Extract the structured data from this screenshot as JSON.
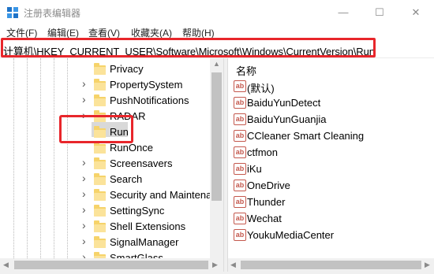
{
  "window": {
    "title": "注册表编辑器",
    "minimize_glyph": "—",
    "maximize_glyph": "☐",
    "close_glyph": "✕"
  },
  "menu": [
    "文件(F)",
    "编辑(E)",
    "查看(V)",
    "收藏夹(A)",
    "帮助(H)"
  ],
  "address": "计算机\\HKEY_CURRENT_USER\\Software\\Microsoft\\Windows\\CurrentVersion\\Run",
  "tree": {
    "items": [
      {
        "label": "Privacy",
        "has_children": false,
        "selected": false
      },
      {
        "label": "PropertySystem",
        "has_children": true,
        "selected": false
      },
      {
        "label": "PushNotifications",
        "has_children": true,
        "selected": false
      },
      {
        "label": "RADAR",
        "has_children": true,
        "selected": false
      },
      {
        "label": "Run",
        "has_children": false,
        "selected": true
      },
      {
        "label": "RunOnce",
        "has_children": false,
        "selected": false
      },
      {
        "label": "Screensavers",
        "has_children": true,
        "selected": false
      },
      {
        "label": "Search",
        "has_children": true,
        "selected": false
      },
      {
        "label": "Security and Maintena",
        "has_children": true,
        "selected": false
      },
      {
        "label": "SettingSync",
        "has_children": true,
        "selected": false
      },
      {
        "label": "Shell Extensions",
        "has_children": true,
        "selected": false
      },
      {
        "label": "SignalManager",
        "has_children": true,
        "selected": false
      },
      {
        "label": "SmartGlass",
        "has_children": true,
        "selected": false
      }
    ]
  },
  "values_pane": {
    "header_name": "名称",
    "icon_glyph": "ab",
    "items": [
      "(默认)",
      "BaiduYunDetect",
      "BaiduYunGuanjia",
      "CCleaner Smart Cleaning",
      "ctfmon",
      "iKu",
      "OneDrive",
      "Thunder",
      "Wechat",
      "YoukuMediaCenter"
    ]
  },
  "colors": {
    "highlight": "#e8262b",
    "folder": "#f6d36a",
    "selection": "#d9d9d9"
  }
}
